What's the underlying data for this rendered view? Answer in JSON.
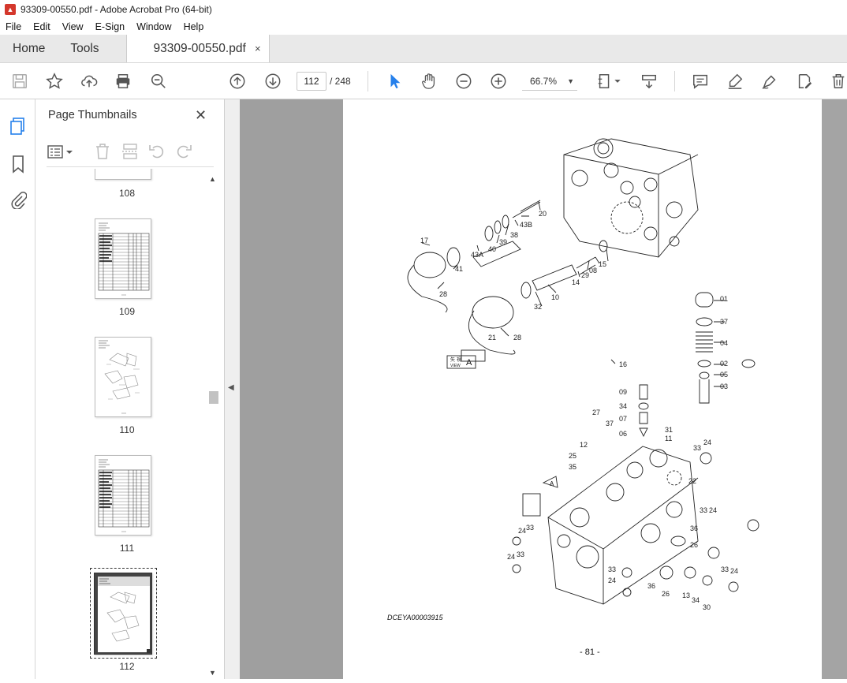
{
  "window": {
    "title": "93309-00550.pdf - Adobe Acrobat Pro (64-bit)"
  },
  "menu": [
    "File",
    "Edit",
    "View",
    "E-Sign",
    "Window",
    "Help"
  ],
  "tabs": {
    "home": "Home",
    "tools": "Tools",
    "document": "93309-00550.pdf",
    "close": "×"
  },
  "toolbar": {
    "current_page": "112",
    "total_pages": "/ 248",
    "zoom": "66.7%"
  },
  "panel": {
    "title": "Page Thumbnails",
    "thumbnails": [
      {
        "label": "108"
      },
      {
        "label": "109"
      },
      {
        "label": "110"
      },
      {
        "label": "111"
      },
      {
        "label": "112"
      }
    ]
  },
  "page": {
    "view_label_cn": "矢 視",
    "view_label": "VIEW",
    "view_letter": "A",
    "detail_letter": "A",
    "drawing_code": "DCEYA00003915",
    "page_number": "- 81 -",
    "callouts": [
      "17",
      "41",
      "28",
      "43A",
      "40",
      "39",
      "38",
      "43B",
      "20",
      "10",
      "32",
      "14",
      "29",
      "08",
      "15",
      "21",
      "28",
      "01",
      "37",
      "04",
      "02",
      "05",
      "03",
      "16",
      "09",
      "34",
      "07",
      "06",
      "31",
      "11",
      "27",
      "37",
      "12",
      "25",
      "35",
      "22",
      "33",
      "24",
      "33",
      "24",
      "36",
      "26",
      "24",
      "33",
      "24",
      "33",
      "33",
      "24",
      "36",
      "26",
      "13",
      "34",
      "30",
      "33",
      "24"
    ]
  },
  "colors": {
    "accent": "#2680eb",
    "pdf_red": "#d4372c"
  }
}
